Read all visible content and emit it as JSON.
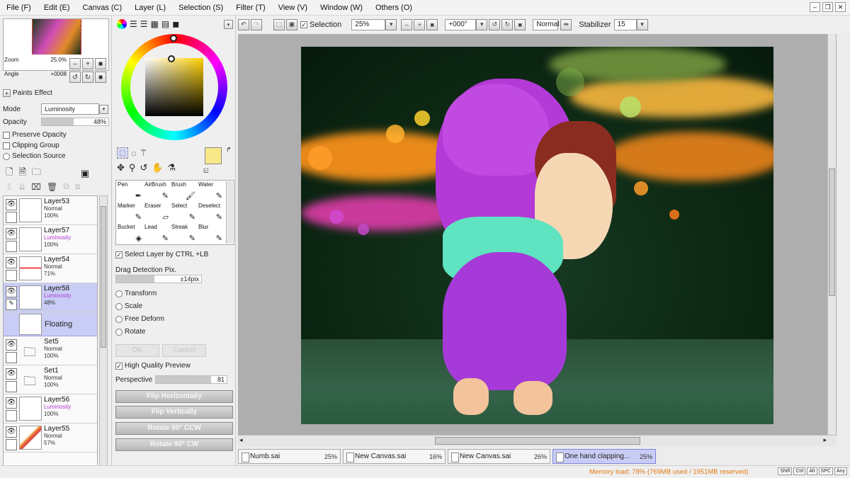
{
  "menu": [
    "File (F)",
    "Edit (E)",
    "Canvas (C)",
    "Layer (L)",
    "Selection (S)",
    "Filter (T)",
    "View (V)",
    "Window (W)",
    "Others (O)"
  ],
  "navigator": {
    "zoom_label": "Zoom",
    "zoom_value": "25.0%",
    "angle_label": "Angle",
    "angle_value": "+0008"
  },
  "paints_effect": {
    "header": "Paints Effect",
    "mode_label": "Mode",
    "mode_value": "Luminosity",
    "opacity_label": "Opacity",
    "opacity_value": "48%",
    "opacity_fraction": 0.48,
    "preserve_opacity": "Preserve Opacity",
    "clipping_group": "Clipping Group",
    "selection_source": "Selection Source"
  },
  "layers": [
    {
      "name": "Layer53",
      "mode": "Normal",
      "opacity": "100%",
      "type": "layer"
    },
    {
      "name": "Layer57",
      "mode": "Luminosity",
      "opacity": "100%",
      "type": "layer"
    },
    {
      "name": "Layer54",
      "mode": "Normal",
      "opacity": "71%",
      "type": "layer"
    },
    {
      "name": "Layer58",
      "mode": "Luminosity",
      "opacity": "48%",
      "type": "layer",
      "selected": true
    },
    {
      "name": "Set5",
      "mode": "Normal",
      "opacity": "100%",
      "type": "set"
    },
    {
      "name": "Set1",
      "mode": "Normal",
      "opacity": "100%",
      "type": "set"
    },
    {
      "name": "Layer56",
      "mode": "Luminosity",
      "opacity": "100%",
      "type": "layer"
    },
    {
      "name": "Layer55",
      "mode": "Normal",
      "opacity": "57%",
      "type": "layer"
    }
  ],
  "floating_label": "Floating",
  "tools": [
    {
      "name": "Pen",
      "icon": "✒"
    },
    {
      "name": "AirBrush",
      "icon": "✎"
    },
    {
      "name": "Brush",
      "icon": "🖌"
    },
    {
      "name": "Water",
      "icon": "✎"
    },
    {
      "name": "Marker",
      "icon": "✎"
    },
    {
      "name": "Eraser",
      "icon": "▱"
    },
    {
      "name": "Select",
      "icon": "✎"
    },
    {
      "name": "Deselect",
      "icon": "✎"
    },
    {
      "name": "Bucket",
      "icon": "◈"
    },
    {
      "name": "Lead",
      "icon": "✎"
    },
    {
      "name": "Streak",
      "icon": "✎"
    },
    {
      "name": "Blur",
      "icon": "✎"
    }
  ],
  "options": {
    "select_layer": "Select Layer by CTRL +LB",
    "drag_detection": "Drag Detection Pix.",
    "drag_value": "±14pix",
    "transform": "Transform",
    "scale": "Scale",
    "free_deform": "Free Deform",
    "rotate": "Rotate",
    "ok": "OK",
    "cancel": "Cancel",
    "hq_preview": "High Quality Preview",
    "perspective_label": "Perspective",
    "perspective_value": "81",
    "flip_h": "Flip Horizontally",
    "flip_v": "Flip Vertically",
    "rot_ccw": "Rotate 90° CCW",
    "rot_cw": "Rotate 90° CW"
  },
  "toolbar": {
    "selection_label": "Selection",
    "zoom": "25%",
    "angle": "+000°",
    "blend": "Normal",
    "stabilizer_label": "Stabilizer",
    "stabilizer_value": "15"
  },
  "colors": {
    "primary": "#f8e88a",
    "secondary": "#ffffff",
    "accent": "#c9cdf6",
    "memory": "#e07a10"
  },
  "tabs": [
    {
      "name": "Numb.sai",
      "zoom": "25%"
    },
    {
      "name": "New Canvas.sai",
      "zoom": "16%"
    },
    {
      "name": "New Canvas.sai",
      "zoom": "26%"
    },
    {
      "name": "One hand clapping...",
      "zoom": "25%",
      "active": true
    }
  ],
  "status": {
    "memory": "Memory load: 78% (769MB used / 1951MB reserved)",
    "mods": [
      "Shift",
      "Ctrl",
      "Alt",
      "SPC",
      "Any"
    ]
  }
}
